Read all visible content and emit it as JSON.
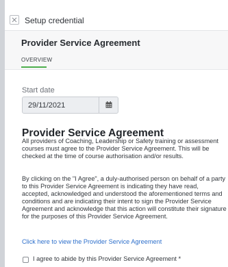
{
  "header": {
    "title": "Setup credential"
  },
  "section": {
    "title": "Provider Service Agreement",
    "tabs": [
      {
        "label": "OVERVIEW",
        "active": true
      }
    ]
  },
  "form": {
    "start_date_label": "Start date",
    "start_date_value": "29/11/2021"
  },
  "agreement": {
    "heading": "Provider Service Agreement",
    "paragraph1": "All providers of Coaching, Leadership or Safety training or assessment courses must agree to the Provider Service Agreement. This will be checked at the time of course authorisation and/or results.",
    "paragraph2": "By clicking on the \"I Agree\", a duly-authorised person on behalf of a party to this Provider Service Agreement is indicating they have read, accepted, acknowledged and understood the aforementioned terms and conditions and are indicating their intent to sign the Provider Service Agreement and acknowledge that this action will constitute their signature for the purposes of this Provider Service Agreement.",
    "link_text": "Click here to view the Provider Service Agreement",
    "checkbox_label": "I agree to abide by this Provider Service Agreement",
    "required_mark": "*"
  },
  "colors": {
    "accent_green": "#4cae4c",
    "link_blue": "#2d6fcb"
  },
  "icons": {
    "close": "close-icon",
    "calendar": "calendar-icon"
  }
}
